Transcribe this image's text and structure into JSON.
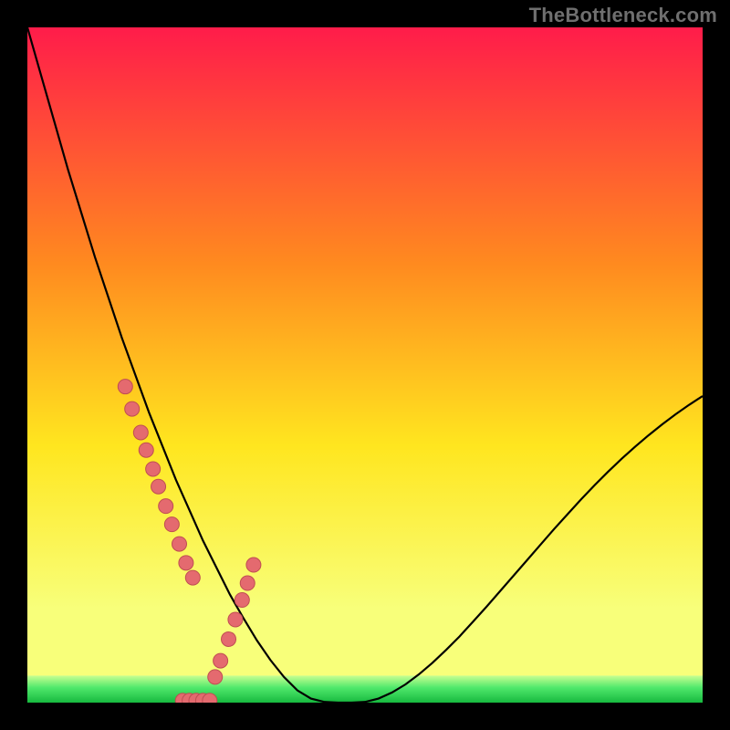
{
  "watermark": "TheBottleneck.com",
  "colors": {
    "frame_bg": "#000000",
    "gradient_top": "#ff1c4a",
    "gradient_mid1": "#ff8a1f",
    "gradient_mid2": "#ffe61f",
    "gradient_low": "#f8ff7a",
    "gradient_green": "#2fe05a",
    "curve": "#000000",
    "marker_fill": "#e46a6f",
    "marker_stroke": "#bf4e52"
  },
  "chart_data": {
    "type": "line",
    "title": "",
    "xlabel": "",
    "ylabel": "",
    "xlim": [
      0,
      100
    ],
    "ylim": [
      0,
      100
    ],
    "grid": false,
    "legend": false,
    "series": [
      {
        "name": "bottleneck-curve",
        "x": [
          0,
          2,
          4,
          6,
          8,
          10,
          12,
          14,
          16,
          18,
          20,
          22,
          24,
          26,
          28,
          30,
          32,
          34,
          36,
          38,
          40,
          42,
          44,
          46,
          48,
          50,
          52,
          54,
          56,
          58,
          60,
          62,
          64,
          66,
          68,
          70,
          72,
          74,
          76,
          78,
          80,
          82,
          84,
          86,
          88,
          90,
          92,
          94,
          96,
          98,
          100
        ],
        "y": [
          100,
          93,
          86,
          79,
          72.5,
          66,
          60,
          54,
          48.5,
          43,
          38,
          33,
          28.5,
          24,
          20,
          16,
          12.5,
          9.2,
          6.3,
          3.8,
          1.8,
          0.6,
          0.1,
          0,
          0,
          0.1,
          0.6,
          1.5,
          2.7,
          4.2,
          5.9,
          7.8,
          9.8,
          12,
          14.2,
          16.5,
          18.8,
          21.1,
          23.4,
          25.7,
          27.9,
          30.1,
          32.2,
          34.2,
          36.1,
          37.9,
          39.6,
          41.2,
          42.7,
          44.1,
          45.4
        ]
      }
    ],
    "markers": {
      "name": "sample-points",
      "x": [
        14.5,
        15.5,
        16.8,
        17.6,
        18.6,
        19.4,
        20.5,
        21.4,
        22.5,
        23.5,
        24.5,
        23.0,
        24.0,
        25.0,
        26.0,
        27.0,
        27.8,
        28.6,
        29.8,
        30.8,
        31.8,
        32.6,
        33.5
      ],
      "y": [
        46.8,
        43.5,
        40.0,
        37.4,
        34.6,
        32.0,
        29.1,
        26.4,
        23.5,
        20.7,
        18.5,
        0.3,
        0.3,
        0.3,
        0.3,
        0.3,
        3.8,
        6.2,
        9.4,
        12.3,
        15.2,
        17.7,
        20.4
      ]
    },
    "green_band": {
      "y0": 0,
      "y1": 4
    }
  }
}
